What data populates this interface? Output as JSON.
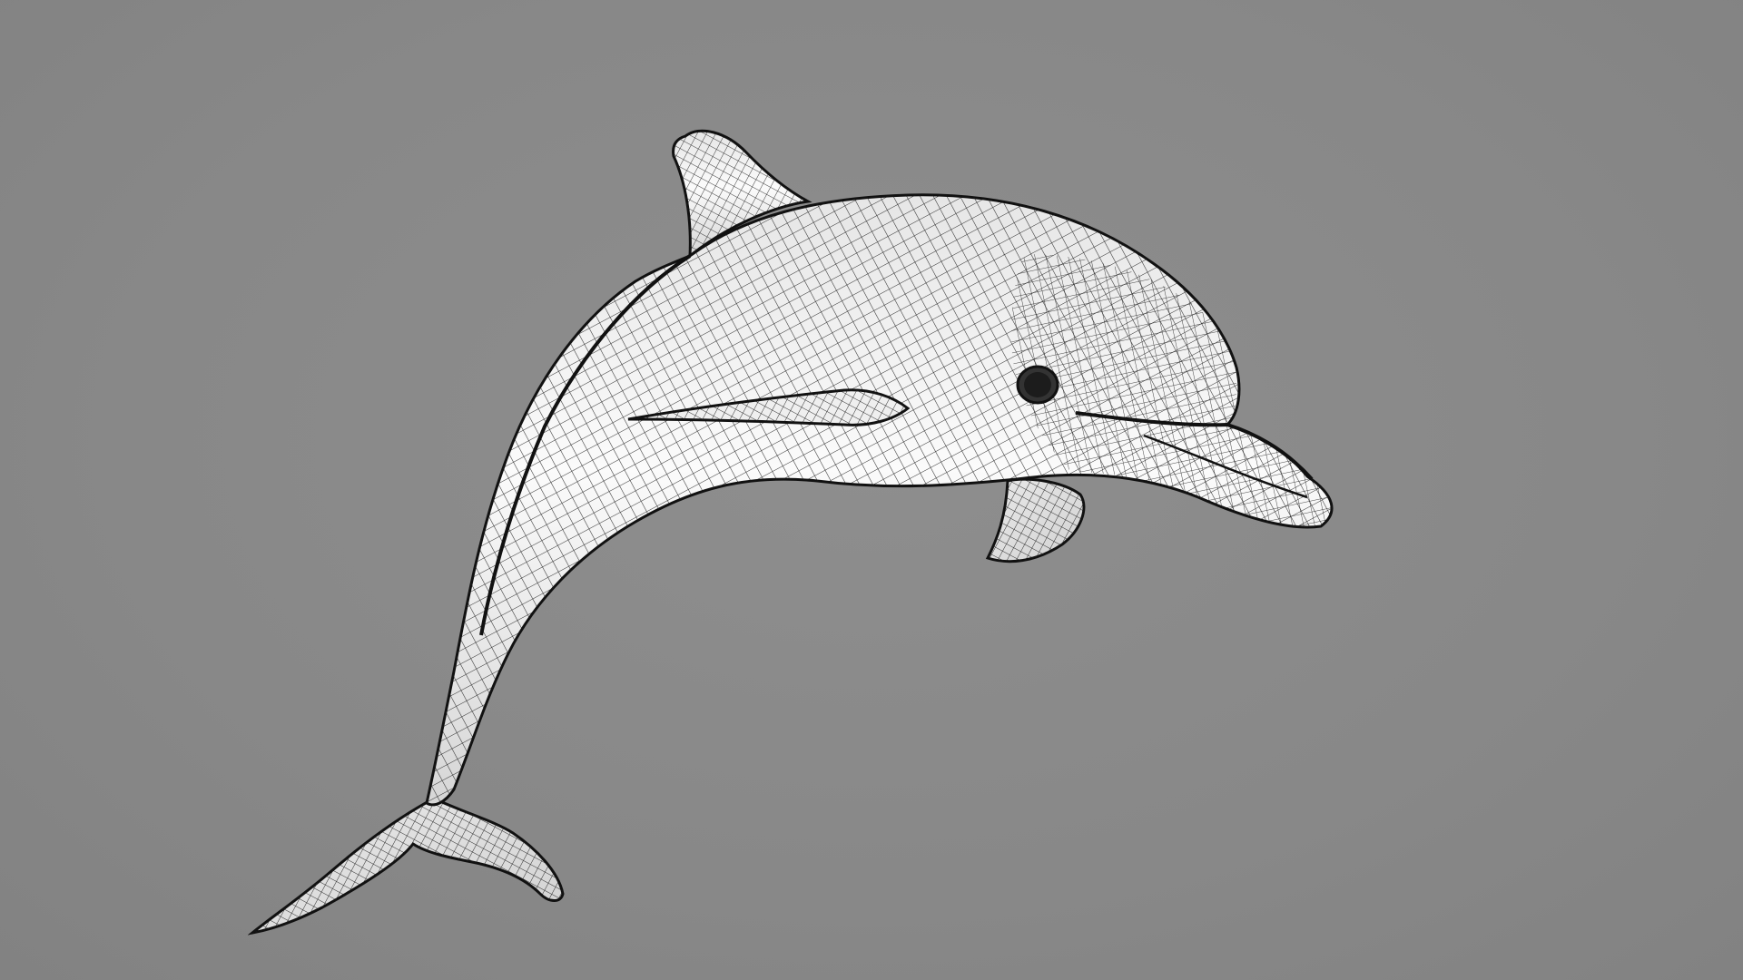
{
  "viewport": {
    "background_color": "#8a8a8a",
    "render_style": "wireframe on shaded",
    "subject": "dolphin-model-icon"
  },
  "model": {
    "surface_color": "#f4f4f4",
    "wire_color": "#1a1a1a",
    "eye_color": "#1c1c1c"
  }
}
